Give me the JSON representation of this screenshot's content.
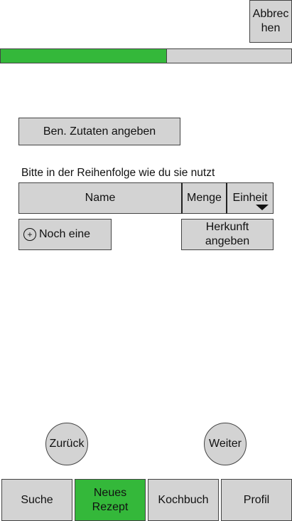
{
  "header": {
    "cancel_label": "Abbrec\nhen"
  },
  "progress": {
    "value_percent": 57,
    "fill_color": "#34b83a",
    "track_color": "#d3d3d3"
  },
  "main": {
    "ingredients_button": "Ben. Zutaten angeben",
    "hint_text": "Bitte in der Reihenfolge wie du sie nutzt",
    "columns": {
      "name": "Name",
      "amount": "Menge",
      "unit": "Einheit"
    },
    "add_more_label": "Noch eine",
    "origin_label": "Herkunft\nangeben"
  },
  "pager": {
    "back_label": "Zurück",
    "next_label": "Weiter"
  },
  "bottom_nav": {
    "items": [
      {
        "label": "Suche"
      },
      {
        "label": "Neues\nRezept",
        "active_color": "#34b83a"
      },
      {
        "label": "Kochbuch"
      },
      {
        "label": "Profil"
      }
    ]
  }
}
